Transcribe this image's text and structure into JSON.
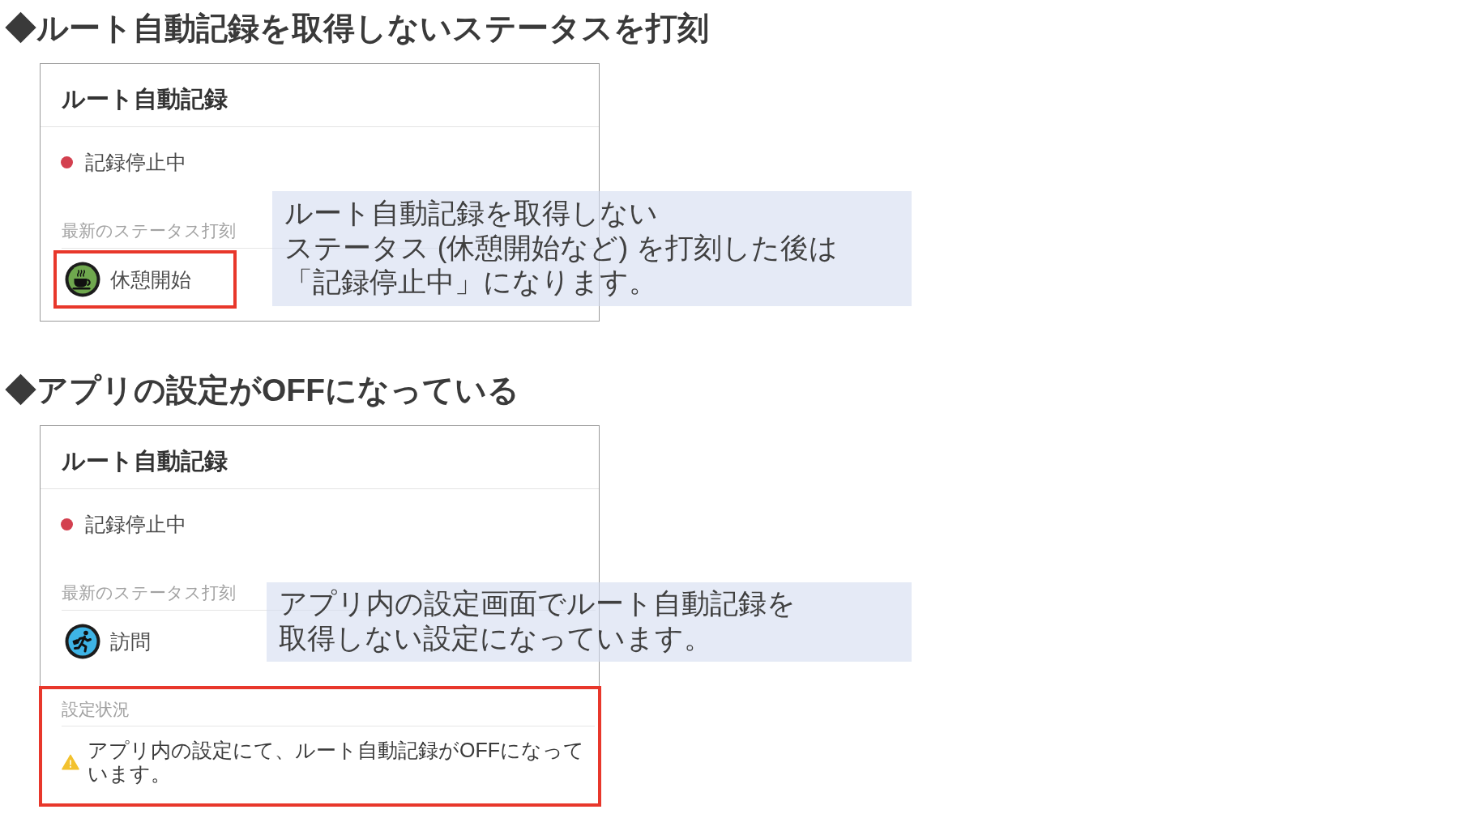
{
  "sections": [
    {
      "heading": "◆ルート自動記録を取得しないステータスを打刻",
      "card": {
        "title": "ルート自動記録",
        "status": {
          "label": "記録停止中",
          "color": "#d3404f"
        },
        "latest_stamp": {
          "label": "最新のステータス打刻",
          "kind": "rest",
          "value": "休憩開始",
          "highlighted": true
        }
      },
      "callout": "ルート自動記録を取得しないステータス (休憩開始など) を打刻した後は「記録停止中」になります。"
    },
    {
      "heading": "◆アプリの設定がOFFになっている",
      "card": {
        "title": "ルート自動記録",
        "status": {
          "label": "記録停止中",
          "color": "#d3404f"
        },
        "latest_stamp": {
          "label": "最新のステータス打刻",
          "kind": "visit",
          "value": "訪問",
          "highlighted": false
        },
        "settings_status": {
          "label": "設定状況",
          "message": "アプリ内の設定にて、ルート自動記録がOFFになっています。",
          "highlighted": true
        }
      },
      "callout": "アプリ内の設定画面でルート自動記録を取得しない設定になっています。"
    }
  ]
}
